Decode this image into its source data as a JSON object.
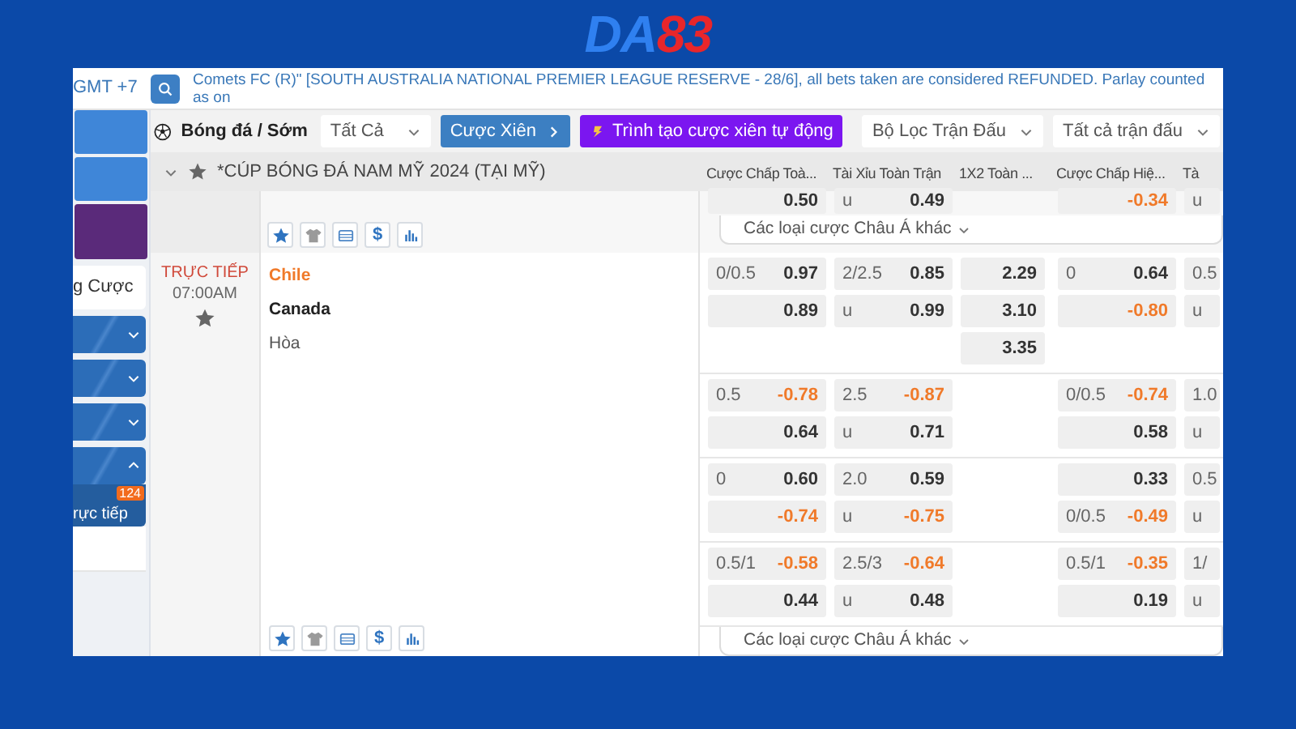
{
  "logo": {
    "part_1": "DA",
    "part_2": "83"
  },
  "top_bar": {
    "timezone": "GMT +7",
    "announcement": "Comets FC (R)\" [SOUTH AUSTRALIA NATIONAL PREMIER LEAGUE RESERVE - 28/6], all bets taken are considered REFUNDED. Parlay counted as on"
  },
  "sidebar": {
    "banners": [
      {
        "kind": "blue"
      },
      {
        "kind": "blue"
      },
      {
        "kind": "purple"
      }
    ],
    "items": [
      {
        "kind": "plain",
        "label": "g Cược"
      },
      {
        "kind": "group",
        "expanded": false
      },
      {
        "kind": "group",
        "expanded": false
      },
      {
        "kind": "group",
        "expanded": false
      },
      {
        "kind": "group",
        "expanded": true,
        "sub_label": "rực tiếp",
        "count": "124"
      }
    ]
  },
  "toolbar": {
    "sport": "Bóng đá / Sớm",
    "market_select": "Tất Cả",
    "parlay_button": "Cược Xiên",
    "auto_parlay_button": "Trình tạo cược xiên tự động",
    "filter_select": "Bộ Lọc Trận Đấu",
    "match_select": "Tất cả trận đấu"
  },
  "league": {
    "name": "*CÚP BÓNG ĐÁ NAM MỸ 2024 (TẠI MỸ)",
    "expanded": true,
    "columns": [
      "Cược Chấp Toà...",
      "Tài Xỉu Toàn Trận",
      "1X2 Toàn ...",
      "Cược Chấp Hiệ...",
      "Tà"
    ],
    "previous_tail": {
      "cells": [
        {
          "odds": "0.50",
          "negative": false
        },
        {
          "line": "u",
          "odds": "0.49",
          "negative": false
        },
        null,
        {
          "odds": "-0.34",
          "negative": true
        },
        {
          "line": "u"
        }
      ],
      "tools": [
        {
          "kind": "star"
        },
        {
          "kind": "jersey"
        },
        {
          "kind": "card"
        },
        {
          "kind": "currency",
          "glyph": "$"
        },
        {
          "kind": "chart"
        }
      ],
      "more_markets": "Các loại cược Châu Á khác"
    }
  },
  "match": {
    "status": "TRỰC TIẾP",
    "time": "07:00AM",
    "home": "Chile",
    "away": "Canada",
    "draw": "Hòa",
    "sets": [
      {
        "rows": [
          [
            {
              "line": "0/0.5",
              "odds": "0.97",
              "negative": false
            },
            {
              "line": "2/2.5",
              "odds": "0.85",
              "negative": false
            },
            {
              "odds": "2.29",
              "negative": false
            },
            {
              "line": "0",
              "odds": "0.64",
              "negative": false
            },
            {
              "line": "0.5"
            }
          ],
          [
            {
              "odds": "0.89",
              "negative": false
            },
            {
              "line": "u",
              "odds": "0.99",
              "negative": false
            },
            {
              "odds": "3.10",
              "negative": false
            },
            {
              "odds": "-0.80",
              "negative": true
            },
            {
              "line": "u"
            }
          ],
          [
            null,
            null,
            {
              "odds": "3.35",
              "negative": false
            },
            null,
            null
          ]
        ]
      },
      {
        "rows": [
          [
            {
              "line": "0.5",
              "odds": "-0.78",
              "negative": true
            },
            {
              "line": "2.5",
              "odds": "-0.87",
              "negative": true
            },
            null,
            {
              "line": "0/0.5",
              "odds": "-0.74",
              "negative": true
            },
            {
              "line": "1.0"
            }
          ],
          [
            {
              "odds": "0.64",
              "negative": false
            },
            {
              "line": "u",
              "odds": "0.71",
              "negative": false
            },
            null,
            {
              "odds": "0.58",
              "negative": false
            },
            {
              "line": "u"
            }
          ]
        ]
      },
      {
        "rows": [
          [
            {
              "line": "0",
              "odds": "0.60",
              "negative": false
            },
            {
              "line": "2.0",
              "odds": "0.59",
              "negative": false
            },
            null,
            {
              "odds": "0.33",
              "negative": false
            },
            {
              "line": "0.5"
            }
          ],
          [
            {
              "odds": "-0.74",
              "negative": true
            },
            {
              "line": "u",
              "odds": "-0.75",
              "negative": true
            },
            null,
            {
              "line": "0/0.5",
              "odds": "-0.49",
              "negative": true
            },
            {
              "line": "u"
            }
          ]
        ]
      },
      {
        "rows": [
          [
            {
              "line": "0.5/1",
              "odds": "-0.58",
              "negative": true
            },
            {
              "line": "2.5/3",
              "odds": "-0.64",
              "negative": true
            },
            null,
            {
              "line": "0.5/1",
              "odds": "-0.35",
              "negative": true
            },
            {
              "line": "1/"
            }
          ],
          [
            {
              "odds": "0.44",
              "negative": false
            },
            {
              "line": "u",
              "odds": "0.48",
              "negative": false
            },
            null,
            {
              "odds": "0.19",
              "negative": false
            },
            {
              "line": "u"
            }
          ]
        ]
      }
    ],
    "tools": [
      {
        "kind": "star"
      },
      {
        "kind": "jersey"
      },
      {
        "kind": "card"
      },
      {
        "kind": "currency",
        "glyph": "$"
      },
      {
        "kind": "chart"
      }
    ],
    "more_markets": "Các loại cược Châu Á khác"
  }
}
